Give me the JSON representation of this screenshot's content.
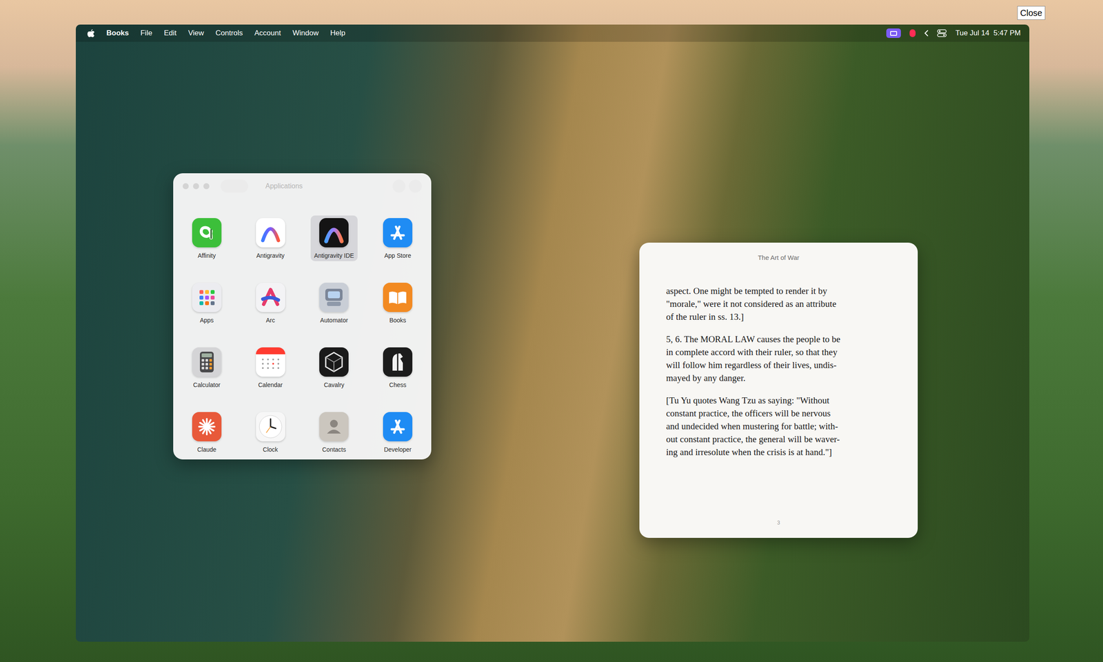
{
  "close_button": "Close",
  "menu_bar": {
    "menus": [
      {
        "label": "Books",
        "kind": "app"
      },
      {
        "label": "File",
        "kind": "menu"
      },
      {
        "label": "Edit",
        "kind": "menu"
      },
      {
        "label": "View",
        "kind": "menu"
      },
      {
        "label": "Controls",
        "kind": "menu"
      },
      {
        "label": "Account",
        "kind": "menu"
      },
      {
        "label": "Window",
        "kind": "menu"
      },
      {
        "label": "Help",
        "kind": "menu"
      }
    ],
    "clock": "Tue Jul 14  5:47 PM"
  },
  "finder": {
    "title": "Applications",
    "apps": [
      {
        "name": "Affinity",
        "selected": false,
        "color": "#3cbf3a"
      },
      {
        "name": "Antigravity",
        "selected": false,
        "color": "#ffffff"
      },
      {
        "name": "Antigravity IDE",
        "selected": true,
        "color": "#141414"
      },
      {
        "name": "App Store",
        "selected": false,
        "color": "#1f8cf4"
      },
      {
        "name": "Apps",
        "selected": false,
        "color": "#ececf0"
      },
      {
        "name": "Arc",
        "selected": false,
        "color": "#f3f3f5"
      },
      {
        "name": "Automator",
        "selected": false,
        "color": "#c9ced6"
      },
      {
        "name": "Books",
        "selected": false,
        "color": "#f28a22"
      },
      {
        "name": "Calculator",
        "selected": false,
        "color": "#d4d4d6"
      },
      {
        "name": "Calendar",
        "selected": false,
        "color": "#ffffff"
      },
      {
        "name": "Cavalry",
        "selected": false,
        "color": "#1a1a1a"
      },
      {
        "name": "Chess",
        "selected": false,
        "color": "#1c1c1c"
      },
      {
        "name": "Claude",
        "selected": false,
        "color": "#e8593a"
      },
      {
        "name": "Clock",
        "selected": false,
        "color": "#f7f7f7"
      },
      {
        "name": "Contacts",
        "selected": false,
        "color": "#cbc6be"
      },
      {
        "name": "Developer",
        "selected": false,
        "color": "#1f8cf4"
      }
    ]
  },
  "book": {
    "title": "The Art of War",
    "paragraphs": [
      [
        "aspect. One might be tempted to render it by",
        "\"morale,\" were it not considered as an attribute",
        "of the ruler in ss. 13.]"
      ],
      [
        "5, 6. The MORAL LAW causes the people to be",
        "in complete accord with their ruler, so that they",
        "will follow him regardless of their lives, undis-",
        "mayed by any danger."
      ],
      [
        "[Tu Yu quotes Wang Tzu as saying: \"Without",
        "constant practice, the officers will be nervous",
        "and undecided when mustering for battle; with-",
        "out constant practice, the general will be waver-",
        "ing and irresolute when the crisis is at hand.\"]"
      ]
    ],
    "page": "3"
  }
}
